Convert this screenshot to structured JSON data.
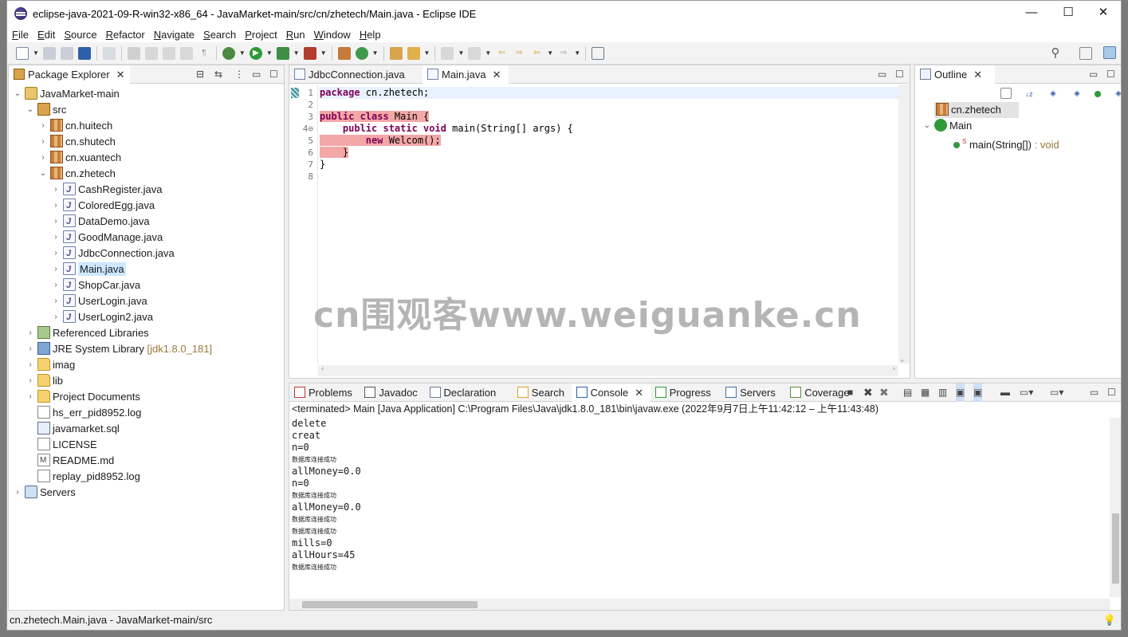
{
  "window": {
    "title": "eclipse-java-2021-09-R-win32-x86_64 - JavaMarket-main/src/cn/zhetech/Main.java - Eclipse IDE",
    "minimize": "—",
    "maximize": "☐",
    "close": "✕"
  },
  "menu": [
    "File",
    "Edit",
    "Source",
    "Refactor",
    "Navigate",
    "Search",
    "Project",
    "Run",
    "Window",
    "Help"
  ],
  "package_explorer": {
    "title": "Package Explorer",
    "tree": [
      {
        "label": "JavaMarket-main",
        "icon": "project-icon",
        "level": 0,
        "twisty": "open"
      },
      {
        "label": "src",
        "icon": "source-folder-icon",
        "level": 1,
        "twisty": "open"
      },
      {
        "label": "cn.huitech",
        "icon": "package-icon",
        "level": 2,
        "twisty": "closed"
      },
      {
        "label": "cn.shutech",
        "icon": "package-icon",
        "level": 2,
        "twisty": "closed"
      },
      {
        "label": "cn.xuantech",
        "icon": "package-icon",
        "level": 2,
        "twisty": "closed"
      },
      {
        "label": "cn.zhetech",
        "icon": "package-icon",
        "level": 2,
        "twisty": "open"
      },
      {
        "label": "CashRegister.java",
        "icon": "java-file-icon",
        "level": 3,
        "twisty": "closed"
      },
      {
        "label": "ColoredEgg.java",
        "icon": "java-file-icon",
        "level": 3,
        "twisty": "closed"
      },
      {
        "label": "DataDemo.java",
        "icon": "java-file-icon",
        "level": 3,
        "twisty": "closed"
      },
      {
        "label": "GoodManage.java",
        "icon": "java-file-icon",
        "level": 3,
        "twisty": "closed"
      },
      {
        "label": "JdbcConnection.java",
        "icon": "java-file-icon",
        "level": 3,
        "twisty": "closed"
      },
      {
        "label": "Main.java",
        "icon": "java-file-icon",
        "level": 3,
        "twisty": "closed",
        "selected": true
      },
      {
        "label": "ShopCar.java",
        "icon": "java-file-icon",
        "level": 3,
        "twisty": "closed"
      },
      {
        "label": "UserLogin.java",
        "icon": "java-file-icon",
        "level": 3,
        "twisty": "closed"
      },
      {
        "label": "UserLogin2.java",
        "icon": "java-file-icon",
        "level": 3,
        "twisty": "closed"
      },
      {
        "label": "Referenced Libraries",
        "icon": "library-icon",
        "level": 1,
        "twisty": "closed"
      },
      {
        "label": "JRE System Library",
        "deco": "[jdk1.8.0_181]",
        "icon": "jre-library-icon",
        "level": 1,
        "twisty": "closed"
      },
      {
        "label": "imag",
        "icon": "folder-icon",
        "level": 1,
        "twisty": "closed"
      },
      {
        "label": "lib",
        "icon": "folder-icon",
        "level": 1,
        "twisty": "closed"
      },
      {
        "label": "Project Documents",
        "icon": "folder-icon",
        "level": 1,
        "twisty": "closed"
      },
      {
        "label": "hs_err_pid8952.log",
        "icon": "file-icon",
        "level": 1,
        "twisty": "none"
      },
      {
        "label": "javamarket.sql",
        "icon": "sql-file-icon",
        "level": 1,
        "twisty": "none"
      },
      {
        "label": "LICENSE",
        "icon": "file-icon",
        "level": 1,
        "twisty": "none"
      },
      {
        "label": "README.md",
        "icon": "markdown-file-icon",
        "level": 1,
        "twisty": "none"
      },
      {
        "label": "replay_pid8952.log",
        "icon": "file-icon",
        "level": 1,
        "twisty": "none"
      },
      {
        "label": "Servers",
        "icon": "servers-folder-icon",
        "level": 0,
        "twisty": "closed"
      }
    ]
  },
  "editor": {
    "tabs": [
      {
        "label": "JdbcConnection.java",
        "active": false
      },
      {
        "label": "Main.java",
        "active": true
      }
    ],
    "lines": [
      {
        "n": "1",
        "parts": [
          {
            "t": "package",
            "k": "kw"
          },
          {
            "t": " cn.zhetech;"
          }
        ]
      },
      {
        "n": "2",
        "parts": []
      },
      {
        "n": "3",
        "parts": [
          {
            "t": "public class",
            "k": "kw",
            "hl": true
          },
          {
            "t": " Main {",
            "hl": true
          }
        ]
      },
      {
        "n": "4⊖",
        "parts": [
          {
            "t": "    "
          },
          {
            "t": "public static void",
            "k": "kw"
          },
          {
            "t": " main(String[] args) {"
          }
        ]
      },
      {
        "n": "5",
        "parts": [
          {
            "t": "        ",
            "hl": true
          },
          {
            "t": "new",
            "k": "kw",
            "hl": true
          },
          {
            "t": " Welcom();",
            "hl": true
          }
        ]
      },
      {
        "n": "6",
        "parts": [
          {
            "t": "    }",
            "hl": true
          }
        ]
      },
      {
        "n": "7",
        "parts": [
          {
            "t": "}"
          }
        ]
      },
      {
        "n": "8",
        "parts": []
      }
    ]
  },
  "outline": {
    "title": "Outline",
    "items": [
      {
        "label": "cn.zhetech",
        "icon": "package-icon",
        "selected": true
      },
      {
        "label": "Main",
        "icon": "class-icon"
      },
      {
        "label": "main(String[])",
        "suffix": " : void",
        "icon": "method-icon"
      }
    ]
  },
  "bottom": {
    "tabs": [
      "Problems",
      "Javadoc",
      "Declaration",
      "Search",
      "Console",
      "Progress",
      "Servers",
      "Coverage"
    ],
    "active_tab": "Console",
    "console_header": "<terminated> Main [Java Application] C:\\Program Files\\Java\\jdk1.8.0_181\\bin\\javaw.exe  (2022年9月7日上午11:42:12 – 上午11:43:48)",
    "output": [
      {
        "t": "delete"
      },
      {
        "t": "creat"
      },
      {
        "t": "n=0"
      },
      {
        "t": "数据库连接成功",
        "small": true
      },
      {
        "t": "allMoney=0.0"
      },
      {
        "t": "n=0"
      },
      {
        "t": "数据库连接成功",
        "small": true
      },
      {
        "t": "allMoney=0.0"
      },
      {
        "t": "数据库连接成功",
        "small": true
      },
      {
        "t": "数据库连接成功",
        "small": true
      },
      {
        "t": "mills=0"
      },
      {
        "t": "allHours=45"
      },
      {
        "t": "数据库连接成功",
        "small": true
      }
    ]
  },
  "watermark": "cn围观客www.weiguanke.cn",
  "status": {
    "text": "cn.zhetech.Main.java - JavaMarket-main/src"
  }
}
